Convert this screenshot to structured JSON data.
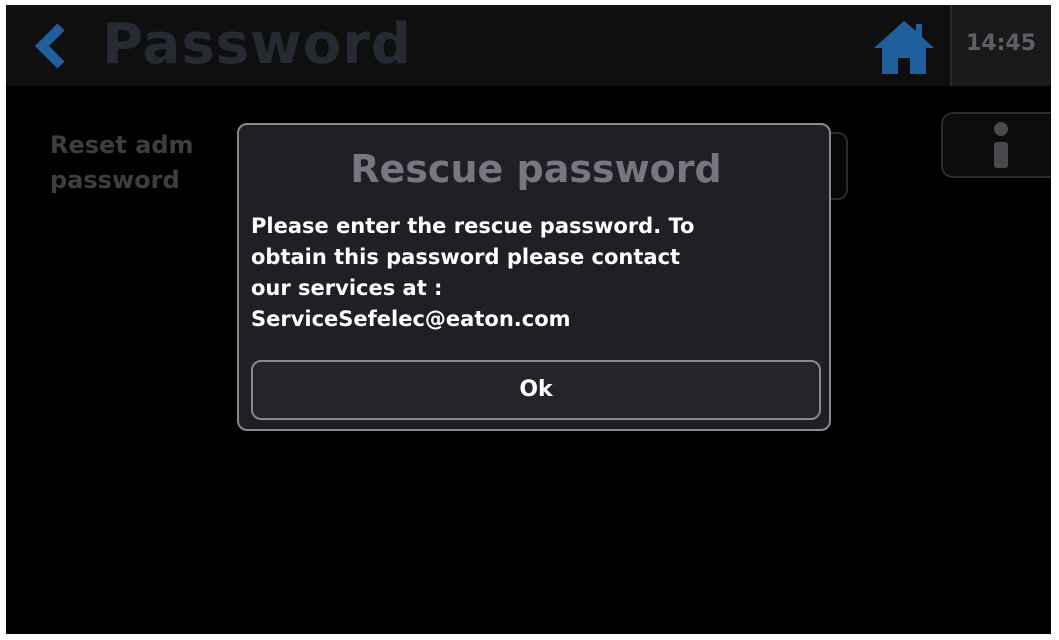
{
  "header": {
    "title": "Password",
    "clock": "14:45",
    "back_icon": "chevron-left-icon",
    "home_icon": "home-icon"
  },
  "background": {
    "reset_label_line1": "Reset adm",
    "reset_label_line2": "password",
    "info_icon": "info-icon"
  },
  "modal": {
    "title": "Rescue password",
    "message_lines": [
      "Please enter the rescue password. To",
      "obtain this password please contact",
      "our services at :",
      "ServiceSefelec@eaton.com"
    ],
    "ok_label": "Ok"
  },
  "colors": {
    "accent_blue": "#1f5f9d",
    "screen_background": "#000000",
    "modal_background": "#1f1f25",
    "modal_border": "#8a8a8e",
    "title_text": "#76787f",
    "body_text": "#ffffff"
  }
}
